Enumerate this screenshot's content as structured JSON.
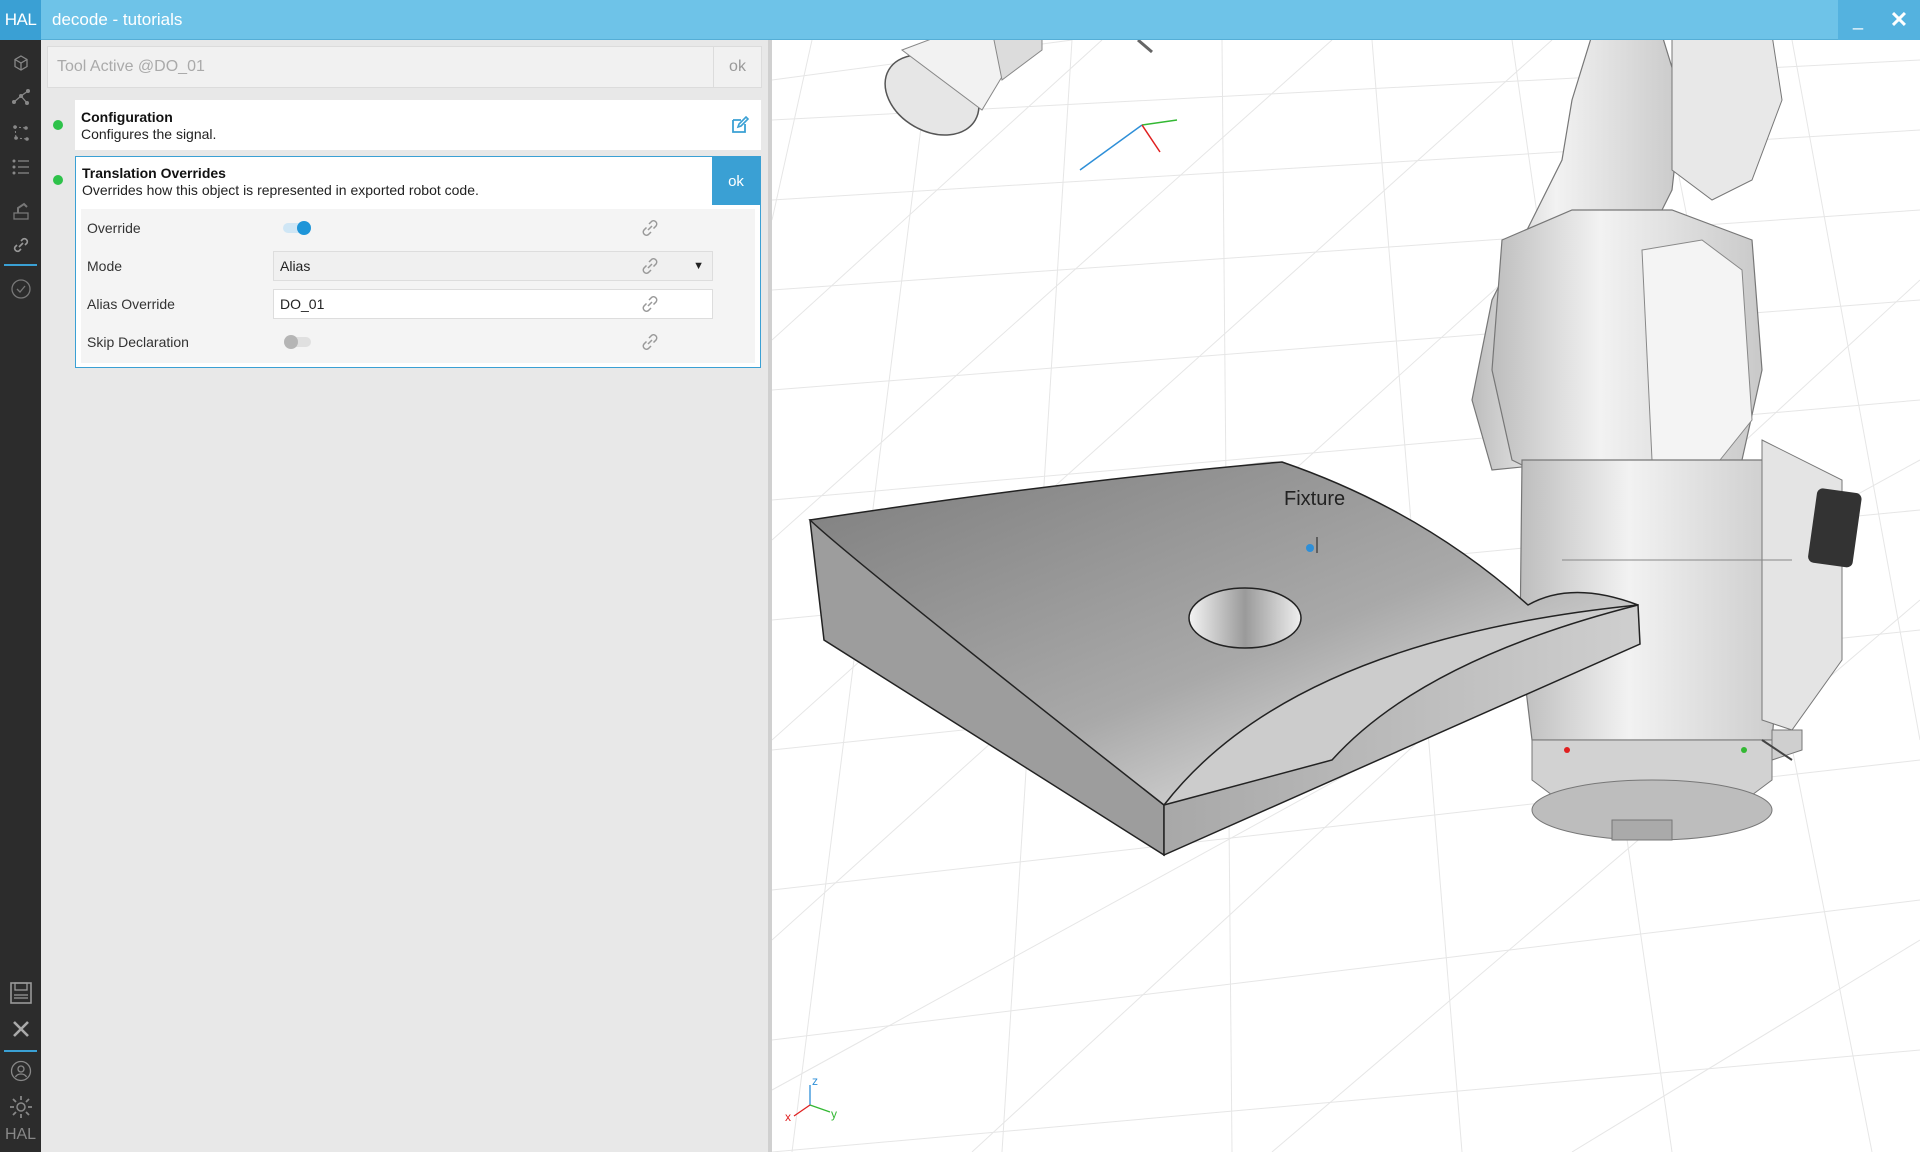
{
  "app": {
    "logo": "HAL",
    "title": "decode - tutorials",
    "minimize": "_",
    "close": "✕"
  },
  "rail": {
    "top_icons": [
      "cube-icon",
      "graph-icon",
      "nodes-icon",
      "list-icon",
      "robot-icon",
      "link-icon",
      "check-circle-icon"
    ],
    "bottom_icons": [
      "save-icon",
      "close-icon",
      "user-icon",
      "gear-icon"
    ],
    "footer_logo": "HAL",
    "accent": "#3aa0d4"
  },
  "panel": {
    "name_value": "Tool Active @DO_01",
    "name_ok": "ok",
    "configuration": {
      "title": "Configuration",
      "description": "Configures the signal.",
      "status_color": "#2ec24a"
    },
    "translation_overrides": {
      "title": "Translation Overrides",
      "description": "Overrides how this object is represented in exported robot code.",
      "ok": "ok",
      "status_color": "#2ec24a",
      "rows": [
        {
          "label": "Override",
          "type": "toggle",
          "on": true
        },
        {
          "label": "Mode",
          "type": "select",
          "value": "Alias",
          "caret": "▼"
        },
        {
          "label": "Alias Override",
          "type": "text",
          "value": "DO_01"
        },
        {
          "label": "Skip Declaration",
          "type": "toggle",
          "on": false
        }
      ]
    }
  },
  "viewport": {
    "object_label": "Fixture",
    "axes": {
      "z": "z",
      "y": "y",
      "x": "x"
    }
  }
}
